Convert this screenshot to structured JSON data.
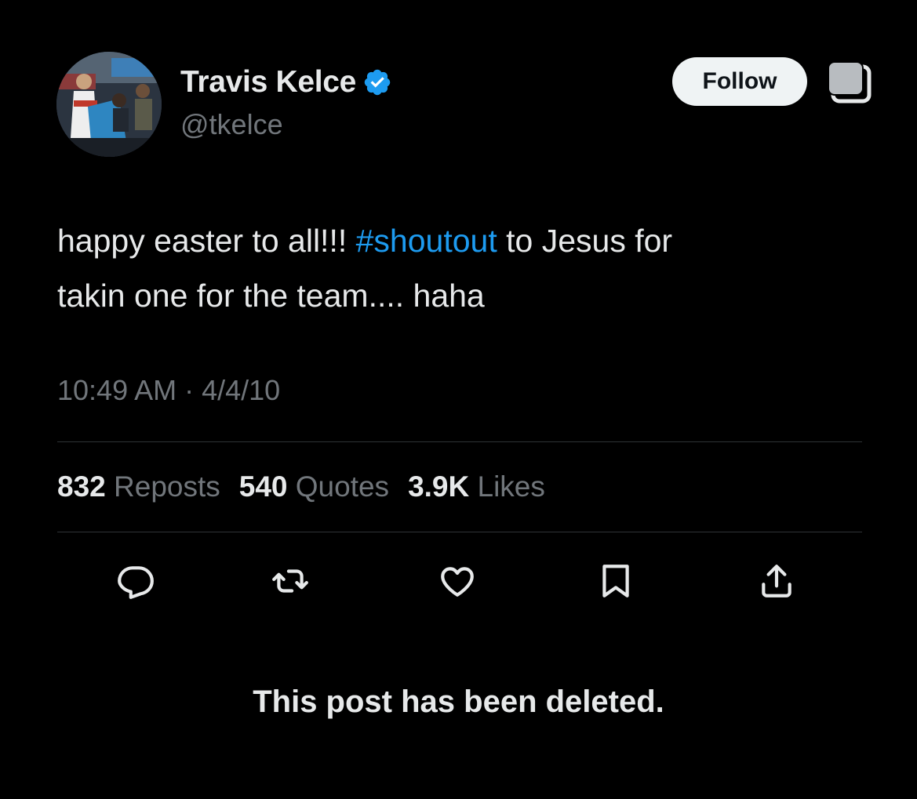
{
  "author": {
    "display_name": "Travis Kelce",
    "handle": "@tkelce",
    "verified": true,
    "avatar_icon": "profile-photo"
  },
  "follow_button": {
    "label": "Follow"
  },
  "more_icon": "stacked-squares-icon",
  "post": {
    "text_before": "happy easter to all!!! ",
    "hashtag": "#shoutout",
    "text_after": " to Jesus for\ntakin one for the team.... haha",
    "timestamp": "10:49 AM · 4/4/10"
  },
  "stats": [
    {
      "count": "832",
      "label": "Reposts"
    },
    {
      "count": "540",
      "label": "Quotes"
    },
    {
      "count": "3.9K",
      "label": "Likes"
    }
  ],
  "actions": [
    {
      "name": "reply",
      "icon": "reply-icon"
    },
    {
      "name": "repost",
      "icon": "repost-icon"
    },
    {
      "name": "like",
      "icon": "heart-icon"
    },
    {
      "name": "bookmark",
      "icon": "bookmark-icon"
    },
    {
      "name": "share",
      "icon": "share-icon"
    }
  ],
  "notice": "This post has been deleted.",
  "colors": {
    "background": "#000000",
    "primary_text": "#e7e9ea",
    "secondary_text": "#71767b",
    "link": "#1d9bf0",
    "verified_badge": "#1d9bf0",
    "divider": "#2f3336",
    "follow_button_bg": "#eff3f4"
  }
}
